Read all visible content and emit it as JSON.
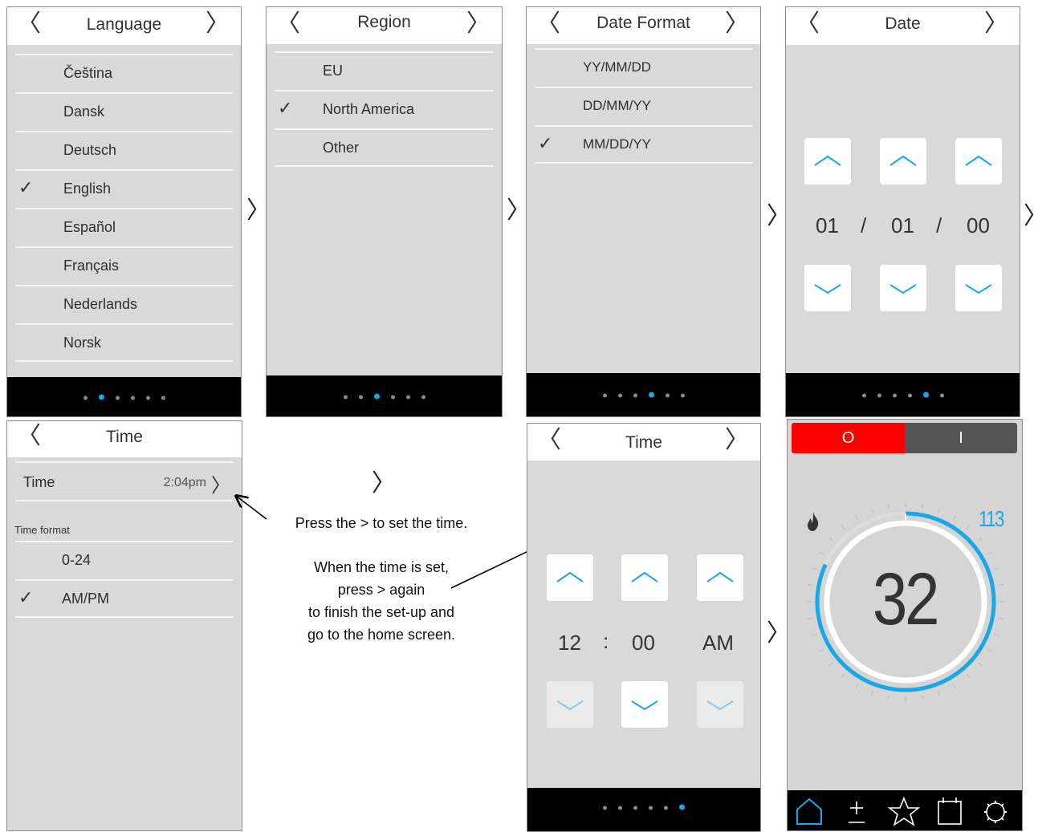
{
  "nav_next_glyph": "〉",
  "nav_prev_glyph": "〈",
  "check_glyph": "✓",
  "language": {
    "title": "Language",
    "items": [
      {
        "label": "Čeština"
      },
      {
        "label": "Dansk"
      },
      {
        "label": "Deutsch"
      },
      {
        "label": "English",
        "selected": true
      },
      {
        "label": "Español"
      },
      {
        "label": "Français"
      },
      {
        "label": "Nederlands"
      },
      {
        "label": "Norsk"
      }
    ],
    "page_dots": 6,
    "active_dot": 2
  },
  "region": {
    "title": "Region",
    "items": [
      {
        "label": "EU"
      },
      {
        "label": "North America",
        "selected": true
      },
      {
        "label": "Other"
      }
    ],
    "page_dots": 6,
    "active_dot": 3
  },
  "date_format": {
    "title": "Date Format",
    "items": [
      {
        "label": "YY/MM/DD"
      },
      {
        "label": "DD/MM/YY"
      },
      {
        "label": "MM/DD/YY",
        "selected": true
      }
    ],
    "page_dots": 6,
    "active_dot": 4
  },
  "date": {
    "title": "Date",
    "month": "01",
    "day": "01",
    "year": "00",
    "separator": "/",
    "page_dots": 6,
    "active_dot": 5
  },
  "time_settings": {
    "title": "Time",
    "time_label": "Time",
    "time_value": "2:04pm",
    "format_header": "Time format",
    "items": [
      {
        "label": "0-24"
      },
      {
        "label": "AM/PM",
        "selected": true
      }
    ]
  },
  "time_set": {
    "title": "Time",
    "hour": "12",
    "minute": "00",
    "ampm": "AM",
    "separator": ":",
    "page_dots": 6,
    "active_dot": 6
  },
  "home": {
    "off_symbol": "O",
    "on_symbol": "I",
    "set_temperature": "113",
    "current_temperature": "32",
    "flame_icon": "flame-icon",
    "nav_icons": [
      "home-icon",
      "plus-minus-icon",
      "star-icon",
      "calendar-icon",
      "gear-icon"
    ]
  },
  "annotations": {
    "press_set_time": "Press the > to set the time.",
    "finish_line1": "When the time is set,",
    "finish_line2": "press > again",
    "finish_line3": "to finish the set-up and",
    "finish_line4": "go to the home screen."
  },
  "colors": {
    "accent_blue": "#1aa7e8",
    "off_red": "#ff0000",
    "on_gray": "#555555",
    "screen_bg": "#d9d9d9"
  }
}
